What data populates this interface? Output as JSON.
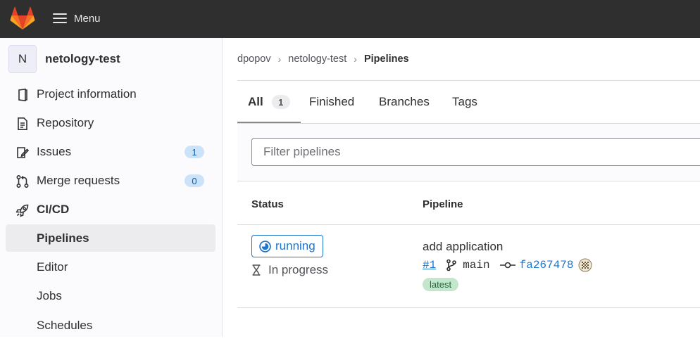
{
  "topbar": {
    "menu_label": "Menu"
  },
  "project": {
    "avatar_letter": "N",
    "name": "netology-test"
  },
  "sidebar": {
    "items": [
      {
        "label": "Project information",
        "icon": "project-icon"
      },
      {
        "label": "Repository",
        "icon": "document-icon"
      },
      {
        "label": "Issues",
        "icon": "issues-icon",
        "badge": "1"
      },
      {
        "label": "Merge requests",
        "icon": "merge-request-icon",
        "badge": "0"
      },
      {
        "label": "CI/CD",
        "icon": "rocket-icon"
      }
    ],
    "subitems": [
      {
        "label": "Pipelines",
        "active": true
      },
      {
        "label": "Editor"
      },
      {
        "label": "Jobs"
      },
      {
        "label": "Schedules"
      }
    ]
  },
  "breadcrumb": [
    "dpopov",
    "netology-test",
    "Pipelines"
  ],
  "tabs": [
    {
      "label": "All",
      "count": "1",
      "active": true
    },
    {
      "label": "Finished"
    },
    {
      "label": "Branches"
    },
    {
      "label": "Tags"
    }
  ],
  "filter": {
    "placeholder": "Filter pipelines"
  },
  "table": {
    "headers": {
      "status": "Status",
      "pipeline": "Pipeline"
    },
    "rows": [
      {
        "status": "running",
        "duration": "In progress",
        "commit_title": "add application",
        "pipeline_id": "#1",
        "branch": "main",
        "sha": "fa267478",
        "tag": "latest"
      }
    ]
  },
  "colors": {
    "accent": "#1f75cb",
    "topbar": "#2f2f2f",
    "latest_bg": "#c3e6cd"
  }
}
